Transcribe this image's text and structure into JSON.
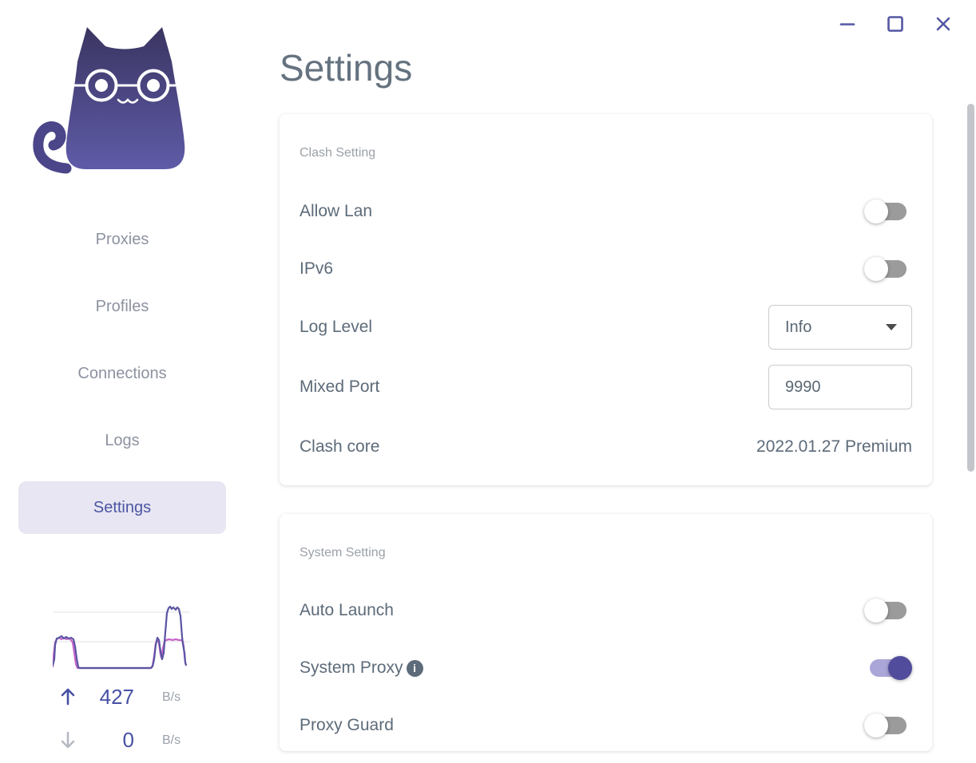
{
  "window": {
    "controls": [
      {
        "name": "minimize"
      },
      {
        "name": "maximize"
      },
      {
        "name": "close"
      }
    ]
  },
  "sidebar": {
    "nav_items": [
      {
        "label": "Proxies",
        "state": ""
      },
      {
        "label": "Profiles",
        "state": ""
      },
      {
        "label": "Connections",
        "state": ""
      },
      {
        "label": "Logs",
        "state": ""
      },
      {
        "label": "Settings",
        "state": "active"
      }
    ],
    "traffic": {
      "upload": {
        "value": "427",
        "unit": "B/s"
      },
      "download": {
        "value": "0",
        "unit": "B/s"
      }
    }
  },
  "main": {
    "title": "Settings",
    "cards": [
      {
        "section": "Clash Setting",
        "rows": [
          {
            "label": "Allow Lan",
            "type": "toggle",
            "state": "off"
          },
          {
            "label": "IPv6",
            "type": "toggle",
            "state": "off"
          },
          {
            "label": "Log Level",
            "type": "select",
            "value": "Info"
          },
          {
            "label": "Mixed Port",
            "type": "input",
            "value": "9990"
          },
          {
            "label": "Clash core",
            "type": "text",
            "value": "2022.01.27 Premium"
          }
        ]
      },
      {
        "section": "System Setting",
        "rows": [
          {
            "label": "Auto Launch",
            "type": "toggle",
            "state": "off"
          },
          {
            "label": "System Proxy",
            "type": "toggle",
            "state": "on",
            "info": "i"
          },
          {
            "label": "Proxy Guard",
            "type": "toggle",
            "state": "off"
          }
        ]
      }
    ]
  },
  "colors": {
    "accent": "#514c9c",
    "toggle_on_track": "#aaa6d8",
    "toggle_off_track": "#9b9b9b",
    "nav_active_bg": "#e7e6f2",
    "nav_active_text": "#4c55a2",
    "graph_line_primary": "#5a55a3",
    "graph_line_secondary": "#c765c9",
    "window_control": "#5457a4"
  }
}
